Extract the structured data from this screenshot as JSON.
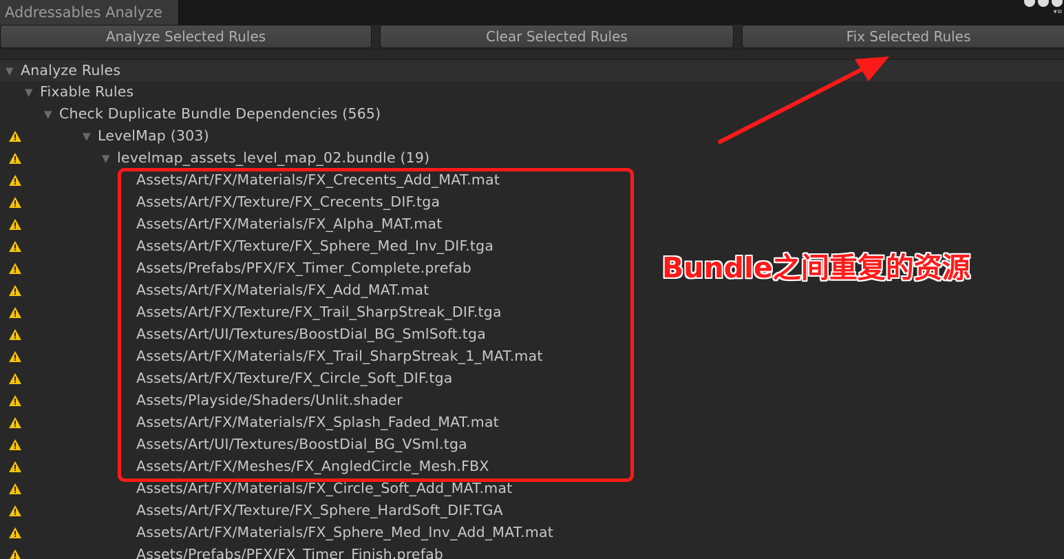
{
  "window": {
    "tab_title": "Addressables Analyze"
  },
  "toolbar": {
    "analyze_label": "Analyze Selected Rules",
    "clear_label": "Clear Selected Rules",
    "fix_label": "Fix Selected Rules"
  },
  "tree": {
    "root": "Analyze Rules",
    "group": "Fixable Rules",
    "rule": "Check Duplicate Bundle Dependencies (565)",
    "bundle_group": "LevelMap (303)",
    "bundle": "levelmap_assets_level_map_02.bundle (19)",
    "items": [
      "Assets/Art/FX/Materials/FX_Crecents_Add_MAT.mat",
      "Assets/Art/FX/Texture/FX_Crecents_DIF.tga",
      "Assets/Art/FX/Materials/FX_Alpha_MAT.mat",
      "Assets/Art/FX/Texture/FX_Sphere_Med_Inv_DIF.tga",
      "Assets/Prefabs/PFX/FX_Timer_Complete.prefab",
      "Assets/Art/FX/Materials/FX_Add_MAT.mat",
      "Assets/Art/FX/Texture/FX_Trail_SharpStreak_DIF.tga",
      "Assets/Art/UI/Textures/BoostDial_BG_SmlSoft.tga",
      "Assets/Art/FX/Materials/FX_Trail_SharpStreak_1_MAT.mat",
      "Assets/Art/FX/Texture/FX_Circle_Soft_DIF.tga",
      "Assets/Playside/Shaders/Unlit.shader",
      "Assets/Art/FX/Materials/FX_Splash_Faded_MAT.mat",
      "Assets/Art/UI/Textures/BoostDial_BG_VSml.tga",
      "Assets/Art/FX/Meshes/FX_AngledCircle_Mesh.FBX",
      "Assets/Art/FX/Materials/FX_Circle_Soft_Add_MAT.mat",
      "Assets/Art/FX/Texture/FX_Sphere_HardSoft_DIF.TGA",
      "Assets/Art/FX/Materials/FX_Sphere_Med_Inv_Add_MAT.mat",
      "Assets/Prefabs/PFX/FX_Timer_Finish.prefab"
    ]
  },
  "annotation": {
    "text": "Bundle之间重复的资源",
    "color": "#ff1a1a"
  },
  "colors": {
    "background": "#282828",
    "warning": "#f5c20a",
    "text": "#c8c8c8"
  }
}
